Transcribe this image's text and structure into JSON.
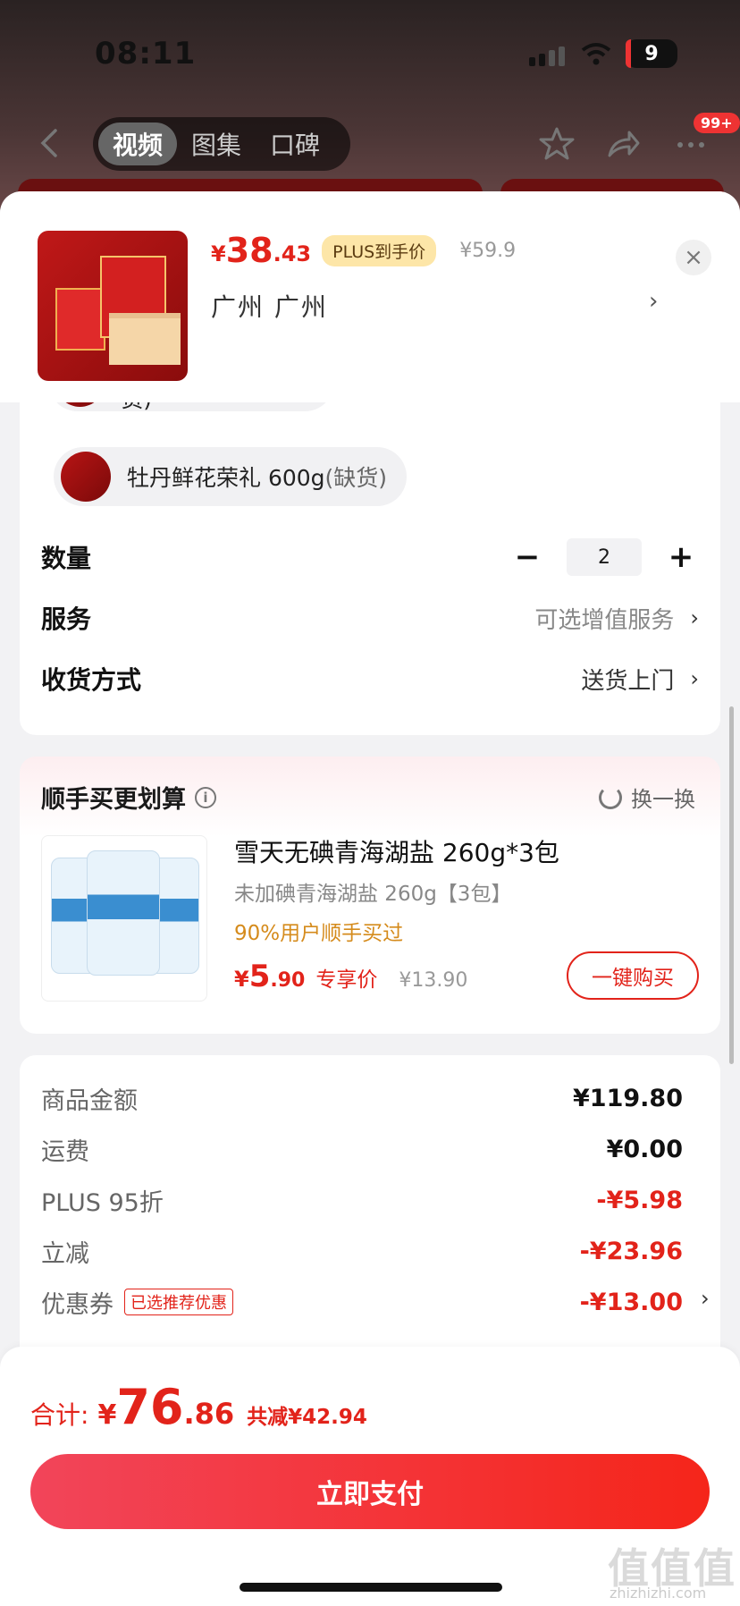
{
  "status_bar": {
    "time": "08:11",
    "battery": "9"
  },
  "nav": {
    "tabs": [
      "视频",
      "图集",
      "口碑"
    ],
    "badge": "99+"
  },
  "product": {
    "price_symbol": "¥",
    "price_int": "38",
    "price_dec": ".43",
    "plus_tag": "PLUS到手价",
    "original_price": "¥59.9",
    "address": "广州  广州",
    "close": "×"
  },
  "spec": {
    "option_partial": "花开富贵礼盒(缺货)",
    "option_label": "牡丹鲜花荣礼 600g",
    "option_status": "(缺货)"
  },
  "quantity": {
    "label": "数量",
    "value": "2",
    "minus": "−",
    "plus": "+"
  },
  "service": {
    "label": "服务",
    "value": "可选增值服务"
  },
  "delivery": {
    "label": "收货方式",
    "value": "送货上门"
  },
  "addon": {
    "title": "顺手买更划算",
    "swap": "换一换",
    "name": "雪天无碘青海湖盐 260g*3包",
    "sub": "未加碘青海湖盐 260g【3包】",
    "hot": "90%用户顺手买过",
    "price_symbol": "¥",
    "price_int": "5",
    "price_dec": ".90",
    "price_tag": "专享价",
    "original_price": "¥13.90",
    "buy": "一键购买"
  },
  "summary": [
    {
      "label": "商品金额",
      "value": "¥119.80",
      "red": false
    },
    {
      "label": "运费",
      "value": "¥0.00",
      "red": false
    },
    {
      "label": "PLUS 95折",
      "value": "-¥5.98",
      "red": true
    },
    {
      "label": "立减",
      "value": "-¥23.96",
      "red": true
    },
    {
      "label": "优惠券",
      "value": "-¥13.00",
      "red": true,
      "tag": "已选推荐优惠"
    }
  ],
  "footer": {
    "total_label": "合计:",
    "total_symbol": "¥",
    "total_int": "76",
    "total_dec": ".86",
    "total_save": "共减¥42.94",
    "pay": "立即支付",
    "watermark": "值值值",
    "watermark_sub": "zhizhizhi.com"
  }
}
